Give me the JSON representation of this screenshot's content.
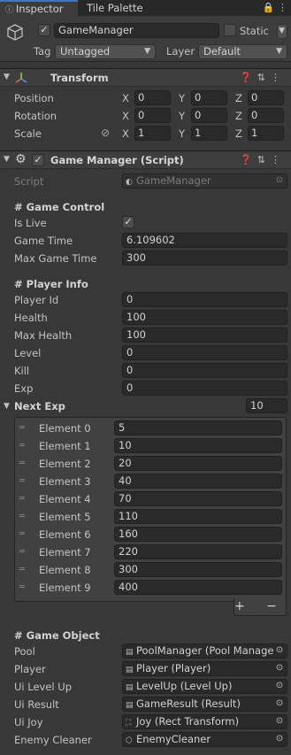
{
  "tabs": {
    "inspector": "Inspector",
    "tile_palette": "Tile Palette",
    "icons": "🔒 ⋮"
  },
  "gameobject": {
    "active_check": "✓",
    "name": "GameManager",
    "static_label": "Static",
    "tag_label": "Tag",
    "tag_value": "Untagged",
    "layer_label": "Layer",
    "layer_value": "Default"
  },
  "transform": {
    "title": "Transform",
    "rows": [
      {
        "label": "Position",
        "x": "0",
        "y": "0",
        "z": "0"
      },
      {
        "label": "Rotation",
        "x": "0",
        "y": "0",
        "z": "0"
      },
      {
        "label": "Scale",
        "x": "1",
        "y": "1",
        "z": "1"
      }
    ],
    "axis": {
      "x": "X",
      "y": "Y",
      "z": "Z"
    }
  },
  "script_component": {
    "title": "Game Manager (Script)",
    "enabled_check": "✓",
    "script_label": "Script",
    "script_value": "GameManager",
    "game_control_header": "# Game Control",
    "is_live_label": "Is Live",
    "is_live_check": "✓",
    "game_time_label": "Game Time",
    "game_time_value": "6.109602",
    "max_game_time_label": "Max Game Time",
    "max_game_time_value": "300",
    "player_info_header": "# Player Info",
    "player_id_label": "Player Id",
    "player_id_value": "0",
    "health_label": "Health",
    "health_value": "100",
    "max_health_label": "Max Health",
    "max_health_value": "100",
    "level_label": "Level",
    "level_value": "0",
    "kill_label": "Kill",
    "kill_value": "0",
    "exp_label": "Exp",
    "exp_value": "0",
    "next_exp_label": "Next Exp",
    "next_exp_size": "10",
    "next_exp": [
      {
        "label": "Element 0",
        "value": "5"
      },
      {
        "label": "Element 1",
        "value": "10"
      },
      {
        "label": "Element 2",
        "value": "20"
      },
      {
        "label": "Element 3",
        "value": "40"
      },
      {
        "label": "Element 4",
        "value": "70"
      },
      {
        "label": "Element 5",
        "value": "110"
      },
      {
        "label": "Element 6",
        "value": "160"
      },
      {
        "label": "Element 7",
        "value": "220"
      },
      {
        "label": "Element 8",
        "value": "300"
      },
      {
        "label": "Element 9",
        "value": "400"
      }
    ],
    "list_buttons": "+ −",
    "game_object_header": "# Game Object",
    "refs": [
      {
        "label": "Pool",
        "value": "PoolManager (Pool Manager)",
        "icon": "script-icon"
      },
      {
        "label": "Player",
        "value": "Player (Player)",
        "icon": "script-icon"
      },
      {
        "label": "Ui Level Up",
        "value": "LevelUp (Level Up)",
        "icon": "script-icon"
      },
      {
        "label": "Ui Result",
        "value": "GameResult (Result)",
        "icon": "script-icon"
      },
      {
        "label": "Ui Joy",
        "value": "Joy (Rect Transform)",
        "icon": "rect-transform-icon"
      },
      {
        "label": "Enemy Cleaner",
        "value": "EnemyCleaner",
        "icon": "cube-icon"
      }
    ]
  }
}
